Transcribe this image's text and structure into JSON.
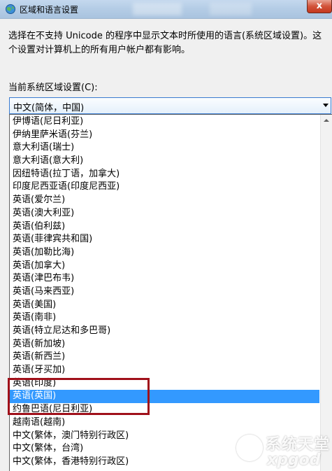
{
  "window": {
    "title": "区域和语言设置",
    "close_label": "x"
  },
  "description": "选择在不支持 Unicode 的程序中显示文本时所使用的语言(系统区域设置)。这个设置对计算机上的所有用户帐户都有影响。",
  "current_locale": {
    "label": "当前系统区域设置(C):",
    "value": "中文(简体，中国)"
  },
  "dropdown": {
    "items": [
      "伊博语(尼日利亚)",
      "伊纳里萨米语(芬兰)",
      "意大利语(瑞士)",
      "意大利语(意大利)",
      "因纽特语(拉丁语，加拿大)",
      "印度尼西亚语(印度尼西亚)",
      "英语(爱尔兰)",
      "英语(澳大利亚)",
      "英语(伯利兹)",
      "英语(菲律宾共和国)",
      "英语(加勒比海)",
      "英语(加拿大)",
      "英语(津巴布韦)",
      "英语(马来西亚)",
      "英语(美国)",
      "英语(南非)",
      "英语(特立尼达和多巴哥)",
      "英语(新加坡)",
      "英语(新西兰)",
      "英语(牙买加)",
      "英语(印度)",
      "英语(英国)",
      "约鲁巴语(尼日利亚)",
      "越南语(越南)",
      "中文(繁体，澳门特别行政区)",
      "中文(繁体，台湾)",
      "中文(繁体，香港特别行政区)"
    ],
    "selected_index": 21,
    "selection_color": "#3399ff"
  },
  "annotation": {
    "color": "#a0101a"
  },
  "watermark": {
    "text_cn": "系统天堂",
    "text_en": "xpgod"
  }
}
